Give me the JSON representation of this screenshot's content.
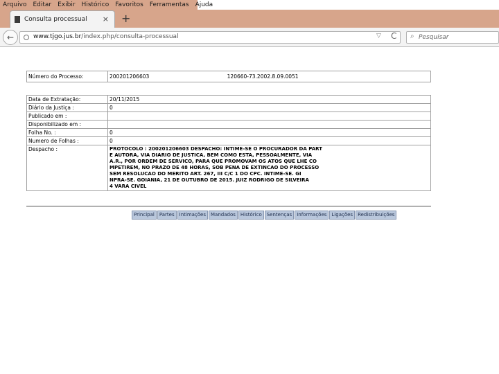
{
  "menu": [
    "Arquivo",
    "Editar",
    "Exibir",
    "Histórico",
    "Favoritos",
    "Ferramentas",
    "Ajuda"
  ],
  "tab": {
    "title": "Consulta processual",
    "close": "×"
  },
  "new_tab": "+",
  "nav": {
    "url_host": "www.tjgo.jus.br",
    "url_path": "/index.php/consulta-processual",
    "search_placeholder": "Pesquisar",
    "back": "←",
    "reload": "C",
    "dropdown": "▽",
    "search_glyph": "⌕"
  },
  "process": {
    "label": "Número do Processo:",
    "number": "200201206603",
    "number2": "120660-73.2002.8.09.0051"
  },
  "details": [
    {
      "label": "Data de Extratação:",
      "value": "20/11/2015"
    },
    {
      "label": "Diário da Justiça :",
      "value": "0"
    },
    {
      "label": "Publicado em :",
      "value": ""
    },
    {
      "label": "Disponibilizado em :",
      "value": ""
    },
    {
      "label": "Folha No. :",
      "value": "0"
    },
    {
      "label": "Numero de Folhas :",
      "value": "0"
    }
  ],
  "despacho": {
    "label": "Despacho :",
    "text": "PROTOCOLO : 200201206603 DESPACHO: INTIME-SE O PROCURADOR DA PART\nE AUTORA, VIA DIARIO DE JUSTICA, BEM COMO ESTA, PESSOALMENTE, VIA\nA.R., POR ORDEM DE SERVICO, PARA QUE PROMOVAM OS ATOS QUE LHE CO\nMPETIREM, NO PRAZO DE 48 HORAS, SOB PENA DE EXTINCAO DO PROCESSO\nSEM RESOLUCAO DO MERITO ART. 267, III C/C 1 DO CPC. INTIME-SE. GI\nNPRA-SE. GOIANIA, 21 DE OUTUBRO DE 2015. JUIZ RODRIGO DE SILVEIRA\n4 VARA CIVEL"
  },
  "bottom_tabs": [
    "Principal",
    "Partes",
    "Intimações",
    "Mandados",
    "Histórico",
    "Sentenças",
    "Informações",
    "Ligações",
    "Redistribuições"
  ]
}
